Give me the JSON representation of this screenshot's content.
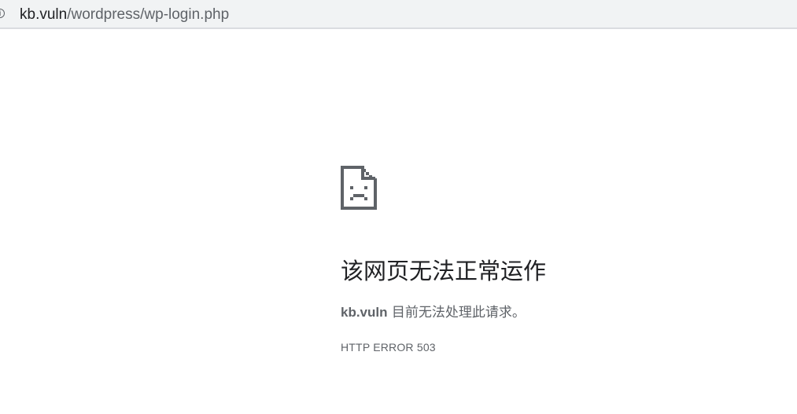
{
  "address_bar": {
    "info_icon": "info-icon",
    "url_host": "kb.vuln",
    "url_path": "/wordpress/wp-login.php"
  },
  "error": {
    "icon": "sad-page-icon",
    "title": "该网页无法正常运作",
    "host": "kb.vuln",
    "message_suffix": " 目前无法处理此请求。",
    "code": "HTTP ERROR 503"
  },
  "colors": {
    "address_bar_bg": "#f1f3f4",
    "text_primary": "#202124",
    "text_secondary": "#5f6368",
    "icon": "#5f6368"
  }
}
